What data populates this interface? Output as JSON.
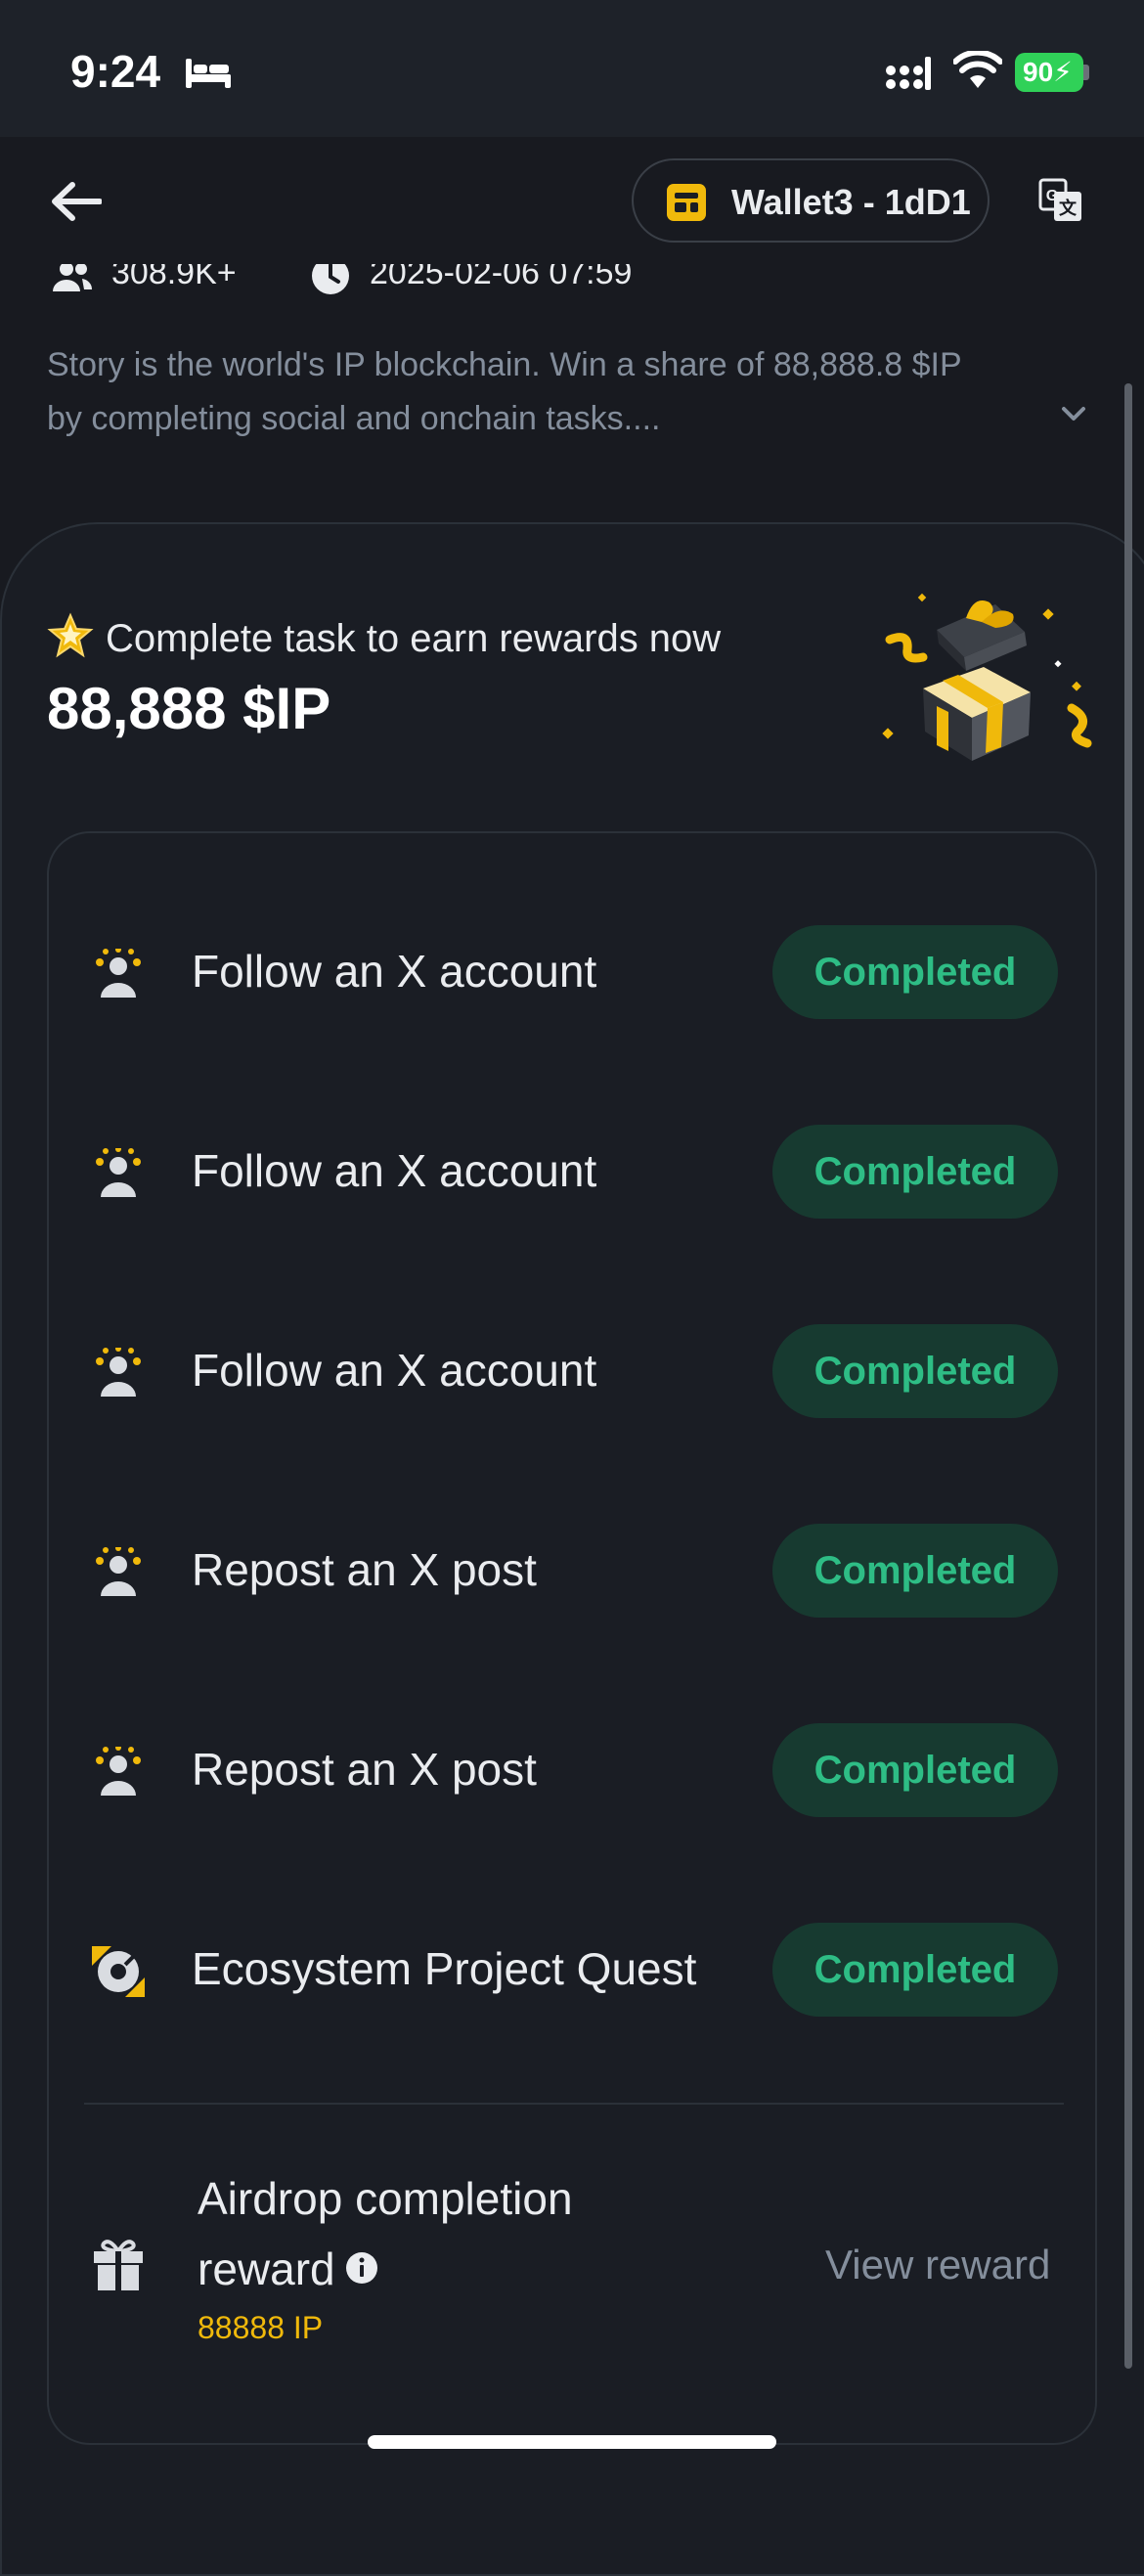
{
  "status_bar": {
    "time": "9:24",
    "battery": "90",
    "icons": [
      "bed-icon",
      "signal-icon",
      "wifi-icon",
      "battery-icon"
    ]
  },
  "header": {
    "wallet_label": "Wallet3 - 1dD1",
    "icons": [
      "back-arrow-icon",
      "wallet-icon",
      "translate-icon"
    ]
  },
  "meta": {
    "participants": "308.9K+",
    "datetime": "2025-02-06 07:59"
  },
  "description": {
    "line1": "Story is the world's IP blockchain. Win a share of 88,888.8 $IP",
    "line2": "by completing social and onchain tasks...."
  },
  "promo": {
    "headline": "Complete task to earn rewards now",
    "amount": "88,888 $IP"
  },
  "tasks": [
    {
      "label": "Follow an X account",
      "status": "Completed",
      "icon": "social-task-icon"
    },
    {
      "label": "Follow an X account",
      "status": "Completed",
      "icon": "social-task-icon"
    },
    {
      "label": "Follow an X account",
      "status": "Completed",
      "icon": "social-task-icon"
    },
    {
      "label": "Repost an X post",
      "status": "Completed",
      "icon": "social-task-icon"
    },
    {
      "label": "Repost an X post",
      "status": "Completed",
      "icon": "social-task-icon"
    },
    {
      "label": "Ecosystem Project Quest",
      "status": "Completed",
      "icon": "ecosystem-quest-icon"
    }
  ],
  "reward": {
    "title_line1": "Airdrop completion",
    "title_line2": "reward",
    "amount": "88888 IP",
    "action": "View reward"
  },
  "colors": {
    "background": "#181a20",
    "accent_yellow": "#f0b90b",
    "completed_green": "#2ebd85",
    "completed_bg": "#173a30",
    "muted_text": "#848e9c"
  }
}
